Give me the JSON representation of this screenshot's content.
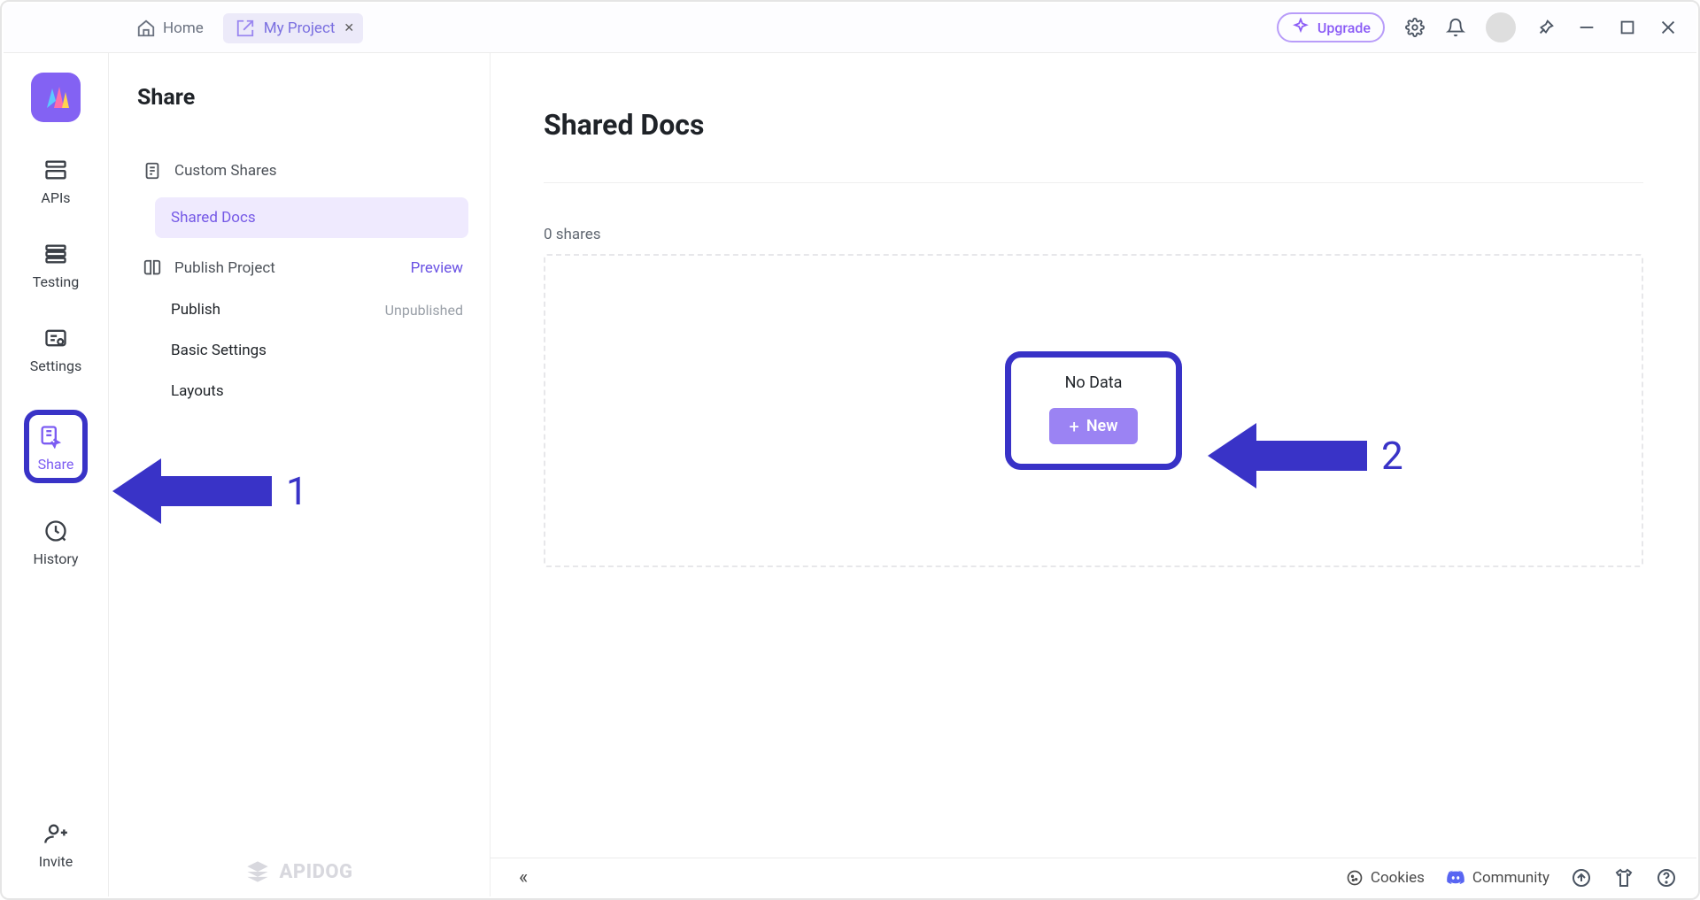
{
  "topbar": {
    "home": "Home",
    "tab": "My Project",
    "upgrade": "Upgrade"
  },
  "rail": {
    "items": [
      {
        "label": "APIs"
      },
      {
        "label": "Testing"
      },
      {
        "label": "Settings"
      },
      {
        "label": "Share"
      },
      {
        "label": "History"
      }
    ],
    "invite": "Invite"
  },
  "subbar": {
    "title": "Share",
    "custom": "Custom Shares",
    "shared": "Shared Docs",
    "publish": "Publish Project",
    "preview": "Preview",
    "rows": [
      {
        "label": "Publish",
        "status": "Unpublished"
      },
      {
        "label": "Basic Settings",
        "status": ""
      },
      {
        "label": "Layouts",
        "status": ""
      }
    ],
    "brand": "APIDOG"
  },
  "main": {
    "title": "Shared Docs",
    "count": "0 shares",
    "nodata": "No Data",
    "newBtn": "New"
  },
  "status": {
    "cookies": "Cookies",
    "community": "Community"
  },
  "annotations": {
    "a1": "1",
    "a2": "2"
  }
}
